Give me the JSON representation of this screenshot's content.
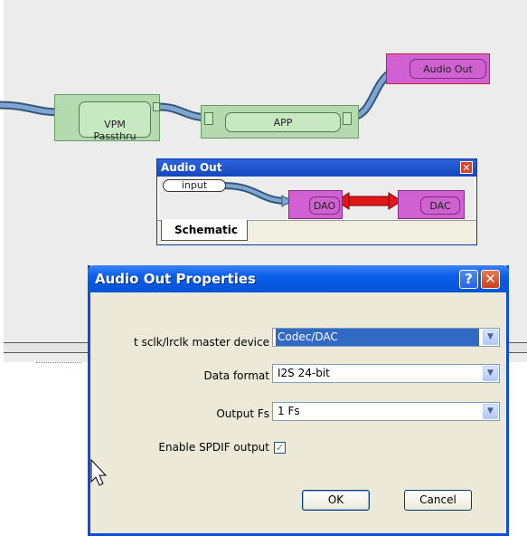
{
  "canvas": {
    "nodes": {
      "vpm_passthru": "VPM\nPassthru",
      "app": "APP",
      "audio_out": "Audio Out"
    }
  },
  "sub_window": {
    "title": "Audio Out",
    "close_glyph": "✕",
    "nodes": {
      "input": "input",
      "dao": "DAO",
      "dac": "DAC"
    },
    "tab": "Schematic"
  },
  "dialog": {
    "title": "Audio Out Properties",
    "help_glyph": "?",
    "close_glyph": "✕",
    "fields": {
      "master_device": {
        "label": "t sclk/lrclk master device",
        "value": "Codec/DAC"
      },
      "data_format": {
        "label": "Data format",
        "value": "I2S 24-bit"
      },
      "output_fs": {
        "label": "Output Fs",
        "value": "1 Fs"
      },
      "spdif": {
        "label": "Enable SPDIF output",
        "checked": true,
        "check_glyph": "✓"
      }
    },
    "dropdown_glyph": "▼",
    "buttons": {
      "ok": "OK",
      "cancel": "Cancel"
    }
  }
}
